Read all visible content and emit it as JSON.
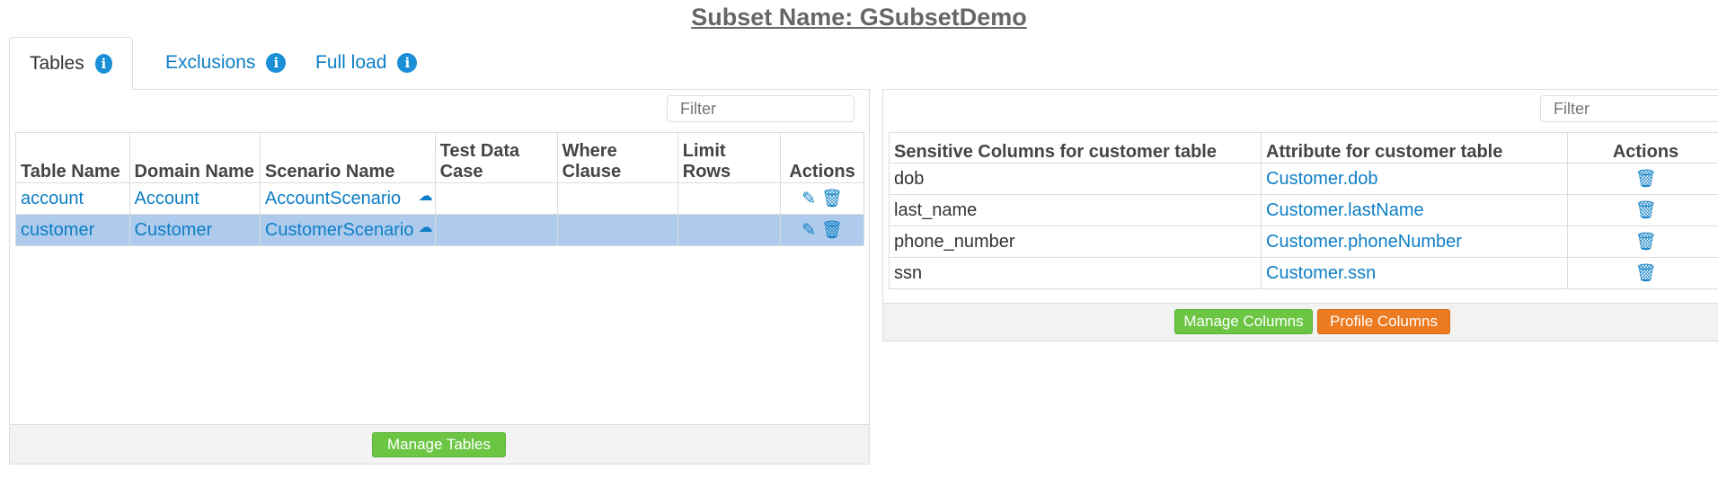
{
  "page": {
    "title": "Subset Name: GSubsetDemo"
  },
  "tabs": [
    {
      "label": "Tables",
      "icon": "info-icon",
      "active": true
    },
    {
      "label": "Exclusions",
      "icon": "info-icon",
      "active": false
    },
    {
      "label": "Full load",
      "icon": "info-icon",
      "active": false
    }
  ],
  "tables_panel": {
    "filter_placeholder": "Filter",
    "headers": {
      "table_name": "Table Name",
      "domain_name": "Domain Name",
      "scenario_name": "Scenario Name",
      "test_data_case": "Test Data Case",
      "where_clause": "Where Clause",
      "limit_rows": "Limit Rows",
      "actions": "Actions"
    },
    "rows": [
      {
        "table_name": "account",
        "domain_name": "Account",
        "scenario_name": "AccountScenario",
        "test_data_case": "",
        "where_clause": "",
        "limit_rows": ""
      },
      {
        "table_name": "customer",
        "domain_name": "Customer",
        "scenario_name": "CustomerScenario",
        "test_data_case": "",
        "where_clause": "",
        "limit_rows": ""
      }
    ],
    "manage_button": "Manage Tables"
  },
  "columns_panel": {
    "filter_placeholder": "Filter",
    "headers": {
      "sensitive_columns": "Sensitive Columns for customer table",
      "attribute": "Attribute for customer table",
      "actions": "Actions"
    },
    "rows": [
      {
        "column": "dob",
        "attribute": "Customer.dob"
      },
      {
        "column": "last_name",
        "attribute": "Customer.lastName"
      },
      {
        "column": "phone_number",
        "attribute": "Customer.phoneNumber"
      },
      {
        "column": "ssn",
        "attribute": "Customer.ssn"
      }
    ],
    "manage_button": "Manage Columns",
    "profile_button": "Profile Columns"
  },
  "colors": {
    "accent": "#0d7ec4",
    "selected_row": "#aecbee",
    "green_button": "#6cc644",
    "orange_button": "#ec7a20"
  }
}
